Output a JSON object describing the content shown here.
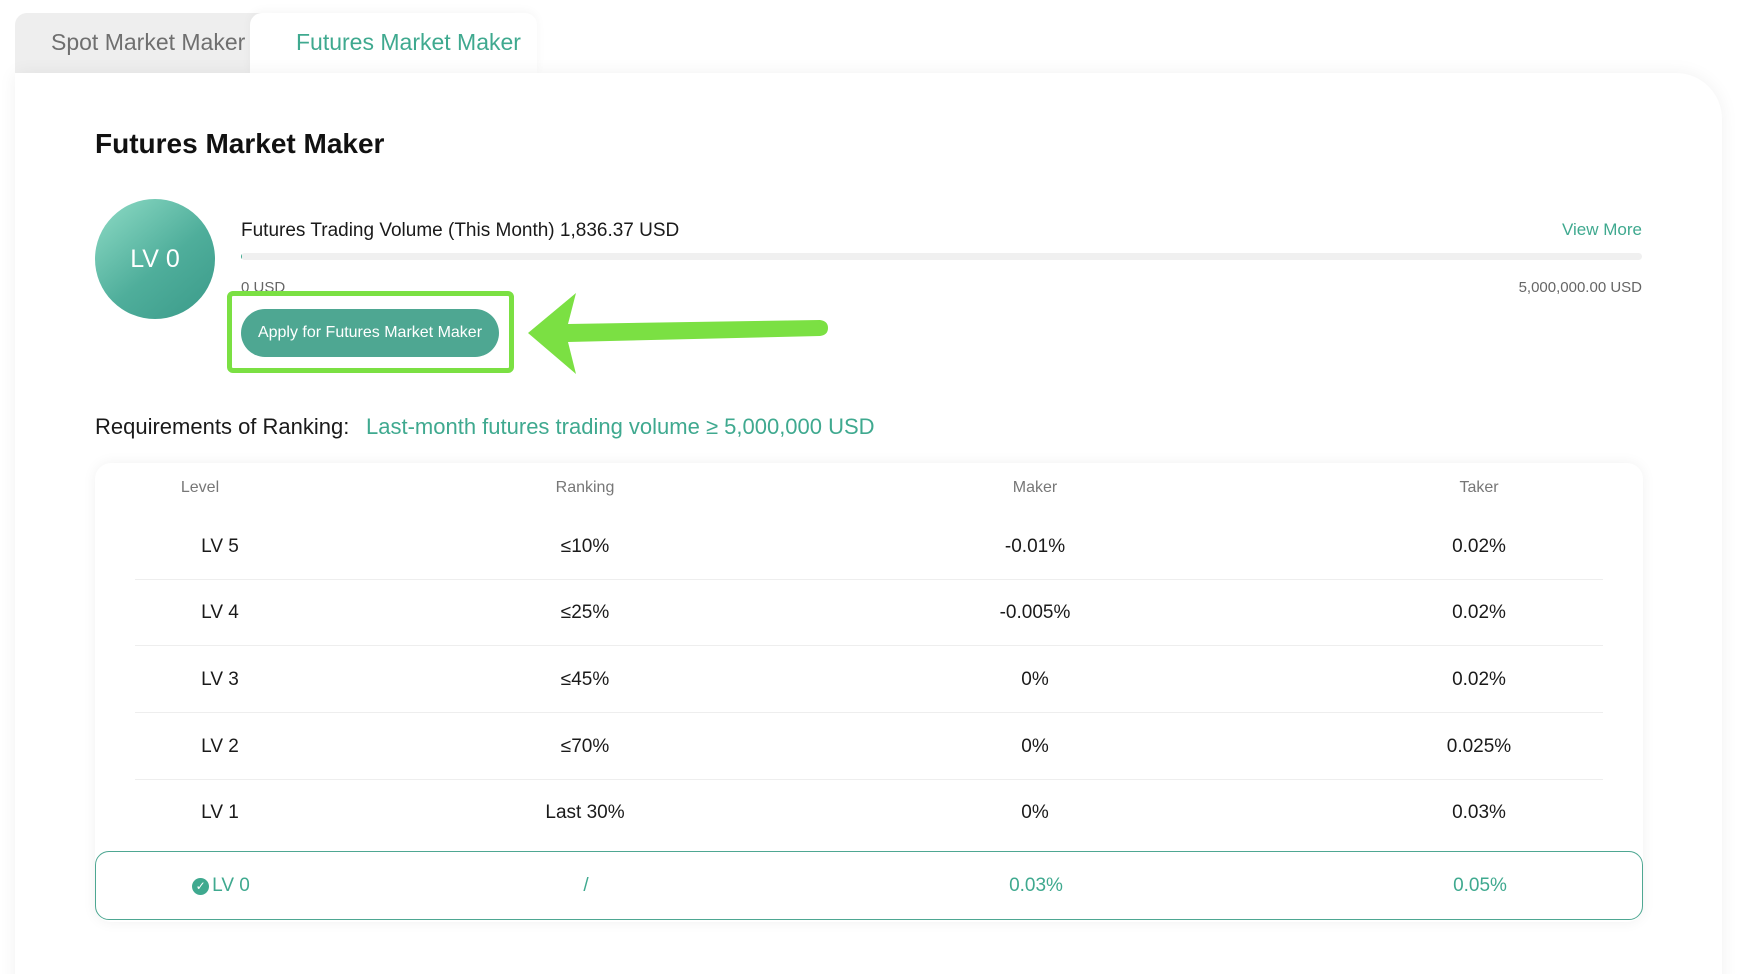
{
  "tabs": {
    "spot_label": "Spot Market Maker",
    "futures_label": "Futures Market Maker",
    "active": "futures"
  },
  "page_title": "Futures Market Maker",
  "level_badge": "LV 0",
  "volume": {
    "label": "Futures Trading Volume (This Month) 1,836.37 USD",
    "view_more": "View More",
    "progress_fraction": 0.0004,
    "min_label": "0 USD",
    "max_label": "5,000,000.00 USD"
  },
  "apply_button": "Apply for Futures Market Maker",
  "requirements": {
    "label": "Requirements of Ranking:",
    "value": "Last-month futures trading volume ≥ 5,000,000 USD"
  },
  "table": {
    "headers": [
      "Level",
      "Ranking",
      "Maker",
      "Taker"
    ],
    "rows": [
      [
        "LV 5",
        "≤10%",
        "-0.01%",
        "0.02%"
      ],
      [
        "LV 4",
        "≤25%",
        "-0.005%",
        "0.02%"
      ],
      [
        "LV 3",
        "≤45%",
        "0%",
        "0.02%"
      ],
      [
        "LV 2",
        "≤70%",
        "0%",
        "0.025%"
      ],
      [
        "LV 1",
        "Last 30%",
        "0%",
        "0.03%"
      ]
    ],
    "current_row": [
      "LV 0",
      "/",
      "0.03%",
      "0.05%"
    ]
  },
  "colors": {
    "accent": "#3fa98f",
    "highlight": "#7be043"
  },
  "icons": {
    "current_level": "check-circle-icon",
    "pointer": "arrow-left-annotation-icon"
  }
}
